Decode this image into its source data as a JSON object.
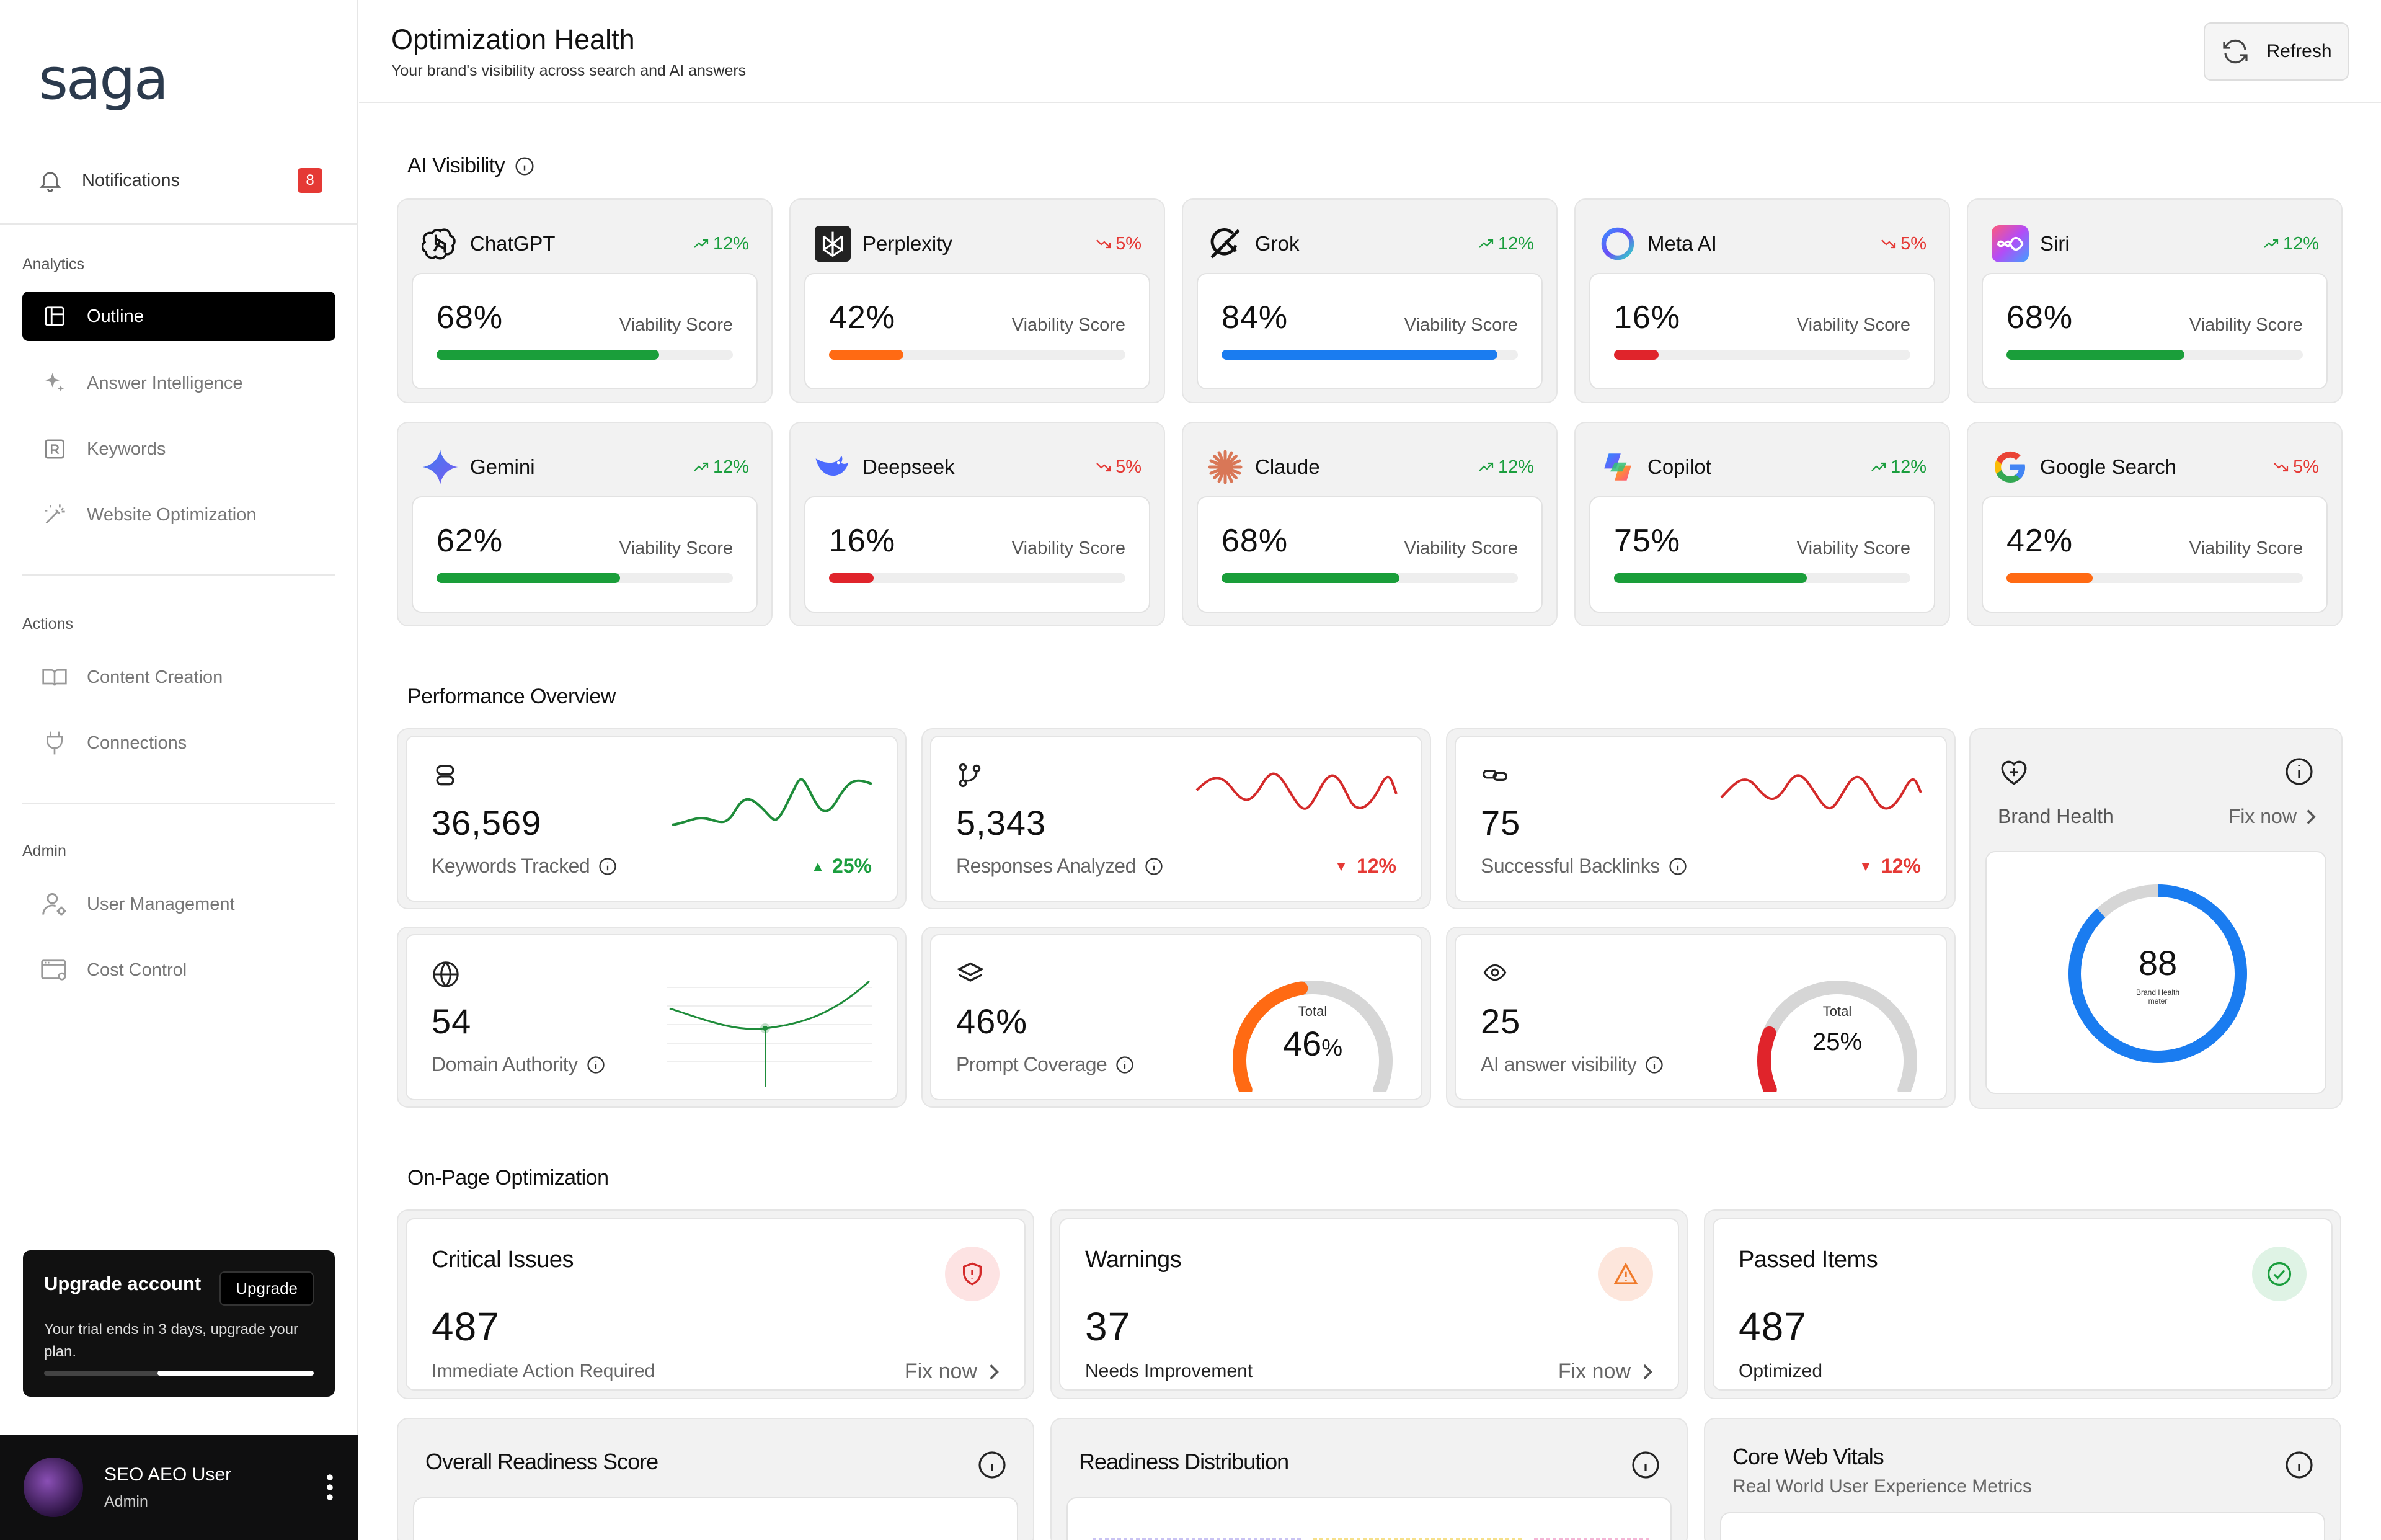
{
  "brand": {
    "logo_text": "saga"
  },
  "sidebar": {
    "notifications": {
      "label": "Notifications",
      "count": "8"
    },
    "sections": {
      "analytics": "Analytics",
      "actions": "Actions",
      "admin": "Admin"
    },
    "items": [
      {
        "label": "Outline",
        "icon": "layout-icon",
        "active": true
      },
      {
        "label": "Answer Intelligence",
        "icon": "sparkle-icon"
      },
      {
        "label": "Keywords",
        "icon": "keyword-box-icon"
      },
      {
        "label": "Website Optimization",
        "icon": "magic-wand-icon"
      },
      {
        "label": "Content Creation",
        "icon": "book-open-icon"
      },
      {
        "label": "Connections",
        "icon": "plug-icon"
      },
      {
        "label": "User Management",
        "icon": "user-gear-icon"
      },
      {
        "label": "Cost Control",
        "icon": "billing-window-icon"
      }
    ],
    "upgrade": {
      "title": "Upgrade account",
      "button": "Upgrade",
      "desc": "Your trial ends in 3 days, upgrade your plan.",
      "progress": 0.58
    },
    "user": {
      "name": "SEO AEO User",
      "role": "Admin"
    }
  },
  "header": {
    "title": "Optimization Health",
    "subtitle": "Your brand's visibility across search and AI answers",
    "refresh": "Refresh"
  },
  "ai_visibility": {
    "title": "AI Visibility",
    "score_label": "Viability Score",
    "items": [
      {
        "name": "ChatGPT",
        "trend": "12%",
        "dir": "up",
        "value": "68%",
        "fill": 0.75,
        "color": "#1a9e3a"
      },
      {
        "name": "Perplexity",
        "trend": "5%",
        "dir": "down",
        "value": "42%",
        "fill": 0.25,
        "color": "#ff6a13"
      },
      {
        "name": "Grok",
        "trend": "12%",
        "dir": "up",
        "value": "84%",
        "fill": 0.93,
        "color": "#1a7cf0"
      },
      {
        "name": "Meta AI",
        "trend": "5%",
        "dir": "down",
        "value": "16%",
        "fill": 0.15,
        "color": "#e0242b"
      },
      {
        "name": "Siri",
        "trend": "12%",
        "dir": "up",
        "value": "68%",
        "fill": 0.6,
        "color": "#1a9e3a"
      },
      {
        "name": "Gemini",
        "trend": "12%",
        "dir": "up",
        "value": "62%",
        "fill": 0.62,
        "color": "#1a9e3a"
      },
      {
        "name": "Deepseek",
        "trend": "5%",
        "dir": "down",
        "value": "16%",
        "fill": 0.15,
        "color": "#e0242b"
      },
      {
        "name": "Claude",
        "trend": "12%",
        "dir": "up",
        "value": "68%",
        "fill": 0.6,
        "color": "#1a9e3a"
      },
      {
        "name": "Copilot",
        "trend": "12%",
        "dir": "up",
        "value": "75%",
        "fill": 0.65,
        "color": "#1a9e3a"
      },
      {
        "name": "Google Search",
        "trend": "5%",
        "dir": "down",
        "value": "42%",
        "fill": 0.29,
        "color": "#ff6a13"
      }
    ]
  },
  "performance": {
    "title": "Performance Overview",
    "cards": [
      {
        "value": "36,569",
        "label": "Keywords Tracked",
        "change": "25%",
        "dir": "up",
        "icon": "stack-icon"
      },
      {
        "value": "5,343",
        "label": "Responses Analyzed",
        "change": "12%",
        "dir": "down",
        "icon": "git-branch-icon"
      },
      {
        "value": "75",
        "label": "Successful Backlinks",
        "change": "12%",
        "dir": "down",
        "icon": "link-icon"
      },
      {
        "value": "54",
        "label": "Domain Authority",
        "icon": "globe-icon"
      },
      {
        "value": "46%",
        "label": "Prompt Coverage",
        "icon": "layers-icon",
        "gauge_label": "Total",
        "gauge_value": "46",
        "gauge_unit": "%",
        "gauge_fill": 0.46
      },
      {
        "value": "25",
        "label": "AI answer visibility",
        "icon": "eye-icon",
        "gauge_label": "Total",
        "gauge_value": "25%",
        "gauge_fill": 0.2
      }
    ],
    "brand_health": {
      "label": "Brand Health",
      "fix": "Fix now",
      "score": "88",
      "caption": "Brand Health meter",
      "fill": 0.88
    }
  },
  "onpage": {
    "title": "On-Page Optimization",
    "cards": [
      {
        "title": "Critical Issues",
        "value": "487",
        "sub": "Immediate Action Required",
        "fix": "Fix now"
      },
      {
        "title": "Warnings",
        "value": "37",
        "sub": "Needs Improvement",
        "fix": "Fix now"
      },
      {
        "title": "Passed Items",
        "value": "487",
        "sub": "Optimized"
      }
    ],
    "bottom": [
      {
        "title": "Overall Readiness Score"
      },
      {
        "title": "Readiness Distribution"
      },
      {
        "title": "Core Web Vitals",
        "sub": "Real World User Experience Metrics"
      }
    ]
  }
}
